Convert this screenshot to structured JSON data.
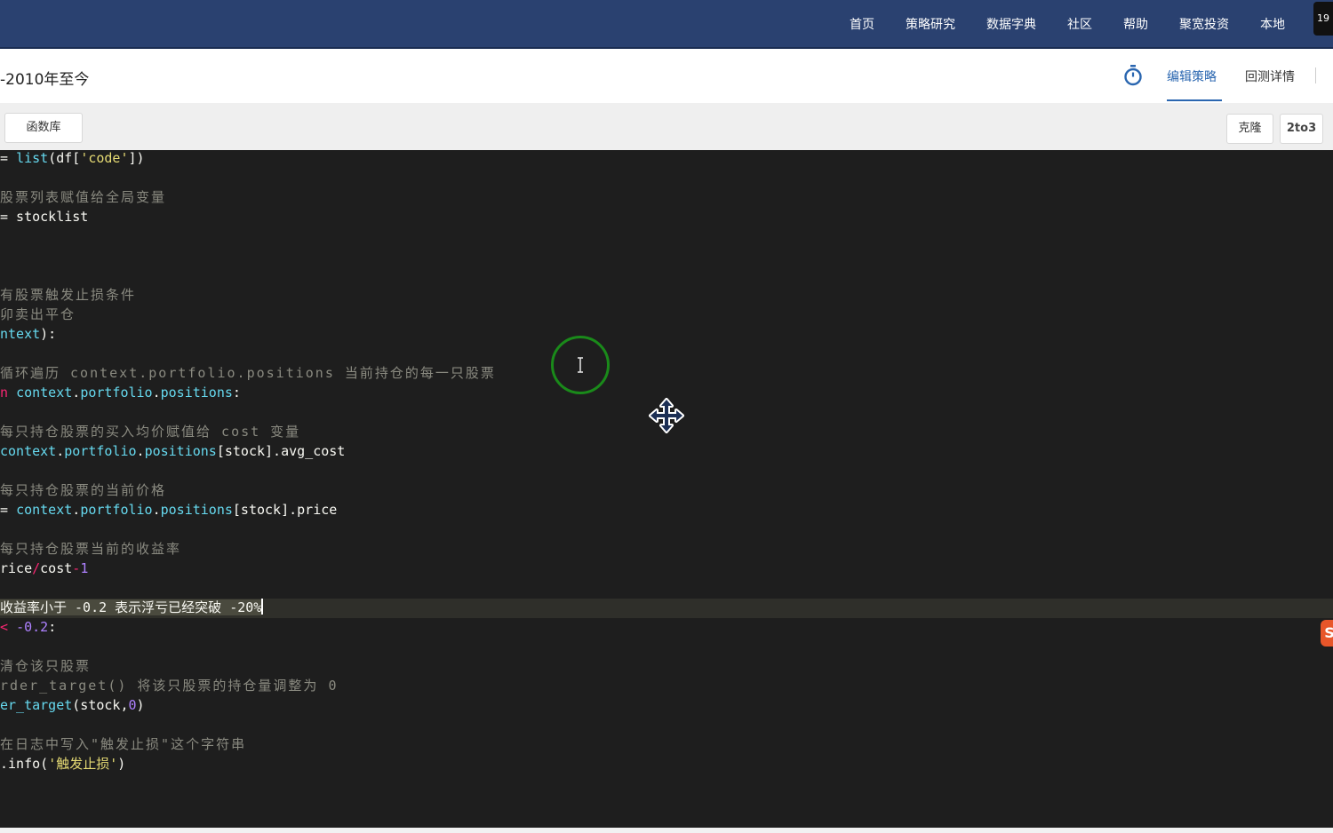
{
  "topnav": {
    "items": [
      "首页",
      "策略研究",
      "数据字典",
      "社区",
      "帮助",
      "聚宽投资",
      "本地"
    ],
    "corner_badge": "19"
  },
  "titlebar": {
    "strategy_title": "-2010年至今",
    "tabs": [
      "编辑策略",
      "回测详情"
    ],
    "active_tab": "编辑策略"
  },
  "toolbar": {
    "function_library": "函数库",
    "clone": "克隆",
    "py2to3": "2to3"
  },
  "code": [
    {
      "segments": [
        {
          "t": "plain",
          "v": "= "
        },
        {
          "t": "fn",
          "v": "list"
        },
        {
          "t": "plain",
          "v": "(df["
        },
        {
          "t": "str",
          "v": "'code'"
        },
        {
          "t": "plain",
          "v": "])"
        }
      ]
    },
    {
      "segments": []
    },
    {
      "segments": [
        {
          "t": "cm",
          "v": "股票列表赋值给全局变量"
        }
      ]
    },
    {
      "segments": [
        {
          "t": "plain",
          "v": "= stocklist"
        }
      ]
    },
    {
      "segments": []
    },
    {
      "segments": []
    },
    {
      "segments": []
    },
    {
      "segments": [
        {
          "t": "cm",
          "v": "有股票触发止损条件"
        }
      ]
    },
    {
      "segments": [
        {
          "t": "cm",
          "v": "卯卖出平仓"
        }
      ]
    },
    {
      "segments": [
        {
          "t": "fn",
          "v": "ntext"
        },
        {
          "t": "plain",
          "v": "):"
        }
      ]
    },
    {
      "segments": []
    },
    {
      "segments": [
        {
          "t": "cm",
          "v": "循环遍历 context.portfolio.positions 当前持仓的每一只股票"
        }
      ]
    },
    {
      "segments": [
        {
          "t": "kw",
          "v": "n"
        },
        {
          "t": "plain",
          "v": " "
        },
        {
          "t": "fn",
          "v": "context"
        },
        {
          "t": "plain",
          "v": "."
        },
        {
          "t": "fn",
          "v": "portfolio"
        },
        {
          "t": "plain",
          "v": "."
        },
        {
          "t": "fn",
          "v": "positions"
        },
        {
          "t": "plain",
          "v": ":"
        }
      ]
    },
    {
      "segments": []
    },
    {
      "segments": [
        {
          "t": "cm",
          "v": "每只持仓股票的买入均价赋值给 cost 变量"
        }
      ]
    },
    {
      "segments": [
        {
          "t": "fn",
          "v": "context"
        },
        {
          "t": "plain",
          "v": "."
        },
        {
          "t": "fn",
          "v": "portfolio"
        },
        {
          "t": "plain",
          "v": "."
        },
        {
          "t": "fn",
          "v": "positions"
        },
        {
          "t": "plain",
          "v": "[stock].avg_cost"
        }
      ]
    },
    {
      "segments": []
    },
    {
      "segments": [
        {
          "t": "cm",
          "v": "每只持仓股票的当前价格"
        }
      ]
    },
    {
      "segments": [
        {
          "t": "plain",
          "v": "= "
        },
        {
          "t": "fn",
          "v": "context"
        },
        {
          "t": "plain",
          "v": "."
        },
        {
          "t": "fn",
          "v": "portfolio"
        },
        {
          "t": "plain",
          "v": "."
        },
        {
          "t": "fn",
          "v": "positions"
        },
        {
          "t": "plain",
          "v": "[stock].price"
        }
      ]
    },
    {
      "segments": []
    },
    {
      "segments": [
        {
          "t": "cm",
          "v": "每只持仓股票当前的收益率"
        }
      ]
    },
    {
      "segments": [
        {
          "t": "plain",
          "v": "rice"
        },
        {
          "t": "kw",
          "v": "/"
        },
        {
          "t": "plain",
          "v": "cost"
        },
        {
          "t": "kw",
          "v": "-"
        },
        {
          "t": "num",
          "v": "1"
        }
      ]
    },
    {
      "segments": []
    },
    {
      "segments": [
        {
          "t": "sel",
          "v": "收益率小于 -0.2 表示浮亏已经突破 -20%"
        }
      ],
      "cursor": true
    },
    {
      "segments": [
        {
          "t": "kw",
          "v": "<"
        },
        {
          "t": "plain",
          "v": " "
        },
        {
          "t": "num",
          "v": "-0.2"
        },
        {
          "t": "plain",
          "v": ":"
        }
      ]
    },
    {
      "segments": []
    },
    {
      "segments": [
        {
          "t": "cm",
          "v": "清仓该只股票"
        }
      ]
    },
    {
      "segments": [
        {
          "t": "cm",
          "v": "rder_target() 将该只股票的持仓量调整为 0"
        }
      ]
    },
    {
      "segments": [
        {
          "t": "fn",
          "v": "er_target"
        },
        {
          "t": "plain",
          "v": "(stock,"
        },
        {
          "t": "num",
          "v": "0"
        },
        {
          "t": "plain",
          "v": ")"
        }
      ]
    },
    {
      "segments": []
    },
    {
      "segments": [
        {
          "t": "cm",
          "v": "在日志中写入\"触发止损\"这个字符串"
        }
      ]
    },
    {
      "segments": [
        {
          "t": "plain",
          "v": ".info("
        },
        {
          "t": "str",
          "v": "'触发止损'"
        },
        {
          "t": "plain",
          "v": ")"
        }
      ]
    }
  ],
  "side_badge": "S",
  "colors": {
    "nav_bg": "#2a4170",
    "accent": "#2a66b0",
    "editor_bg": "#1e1e1e"
  }
}
